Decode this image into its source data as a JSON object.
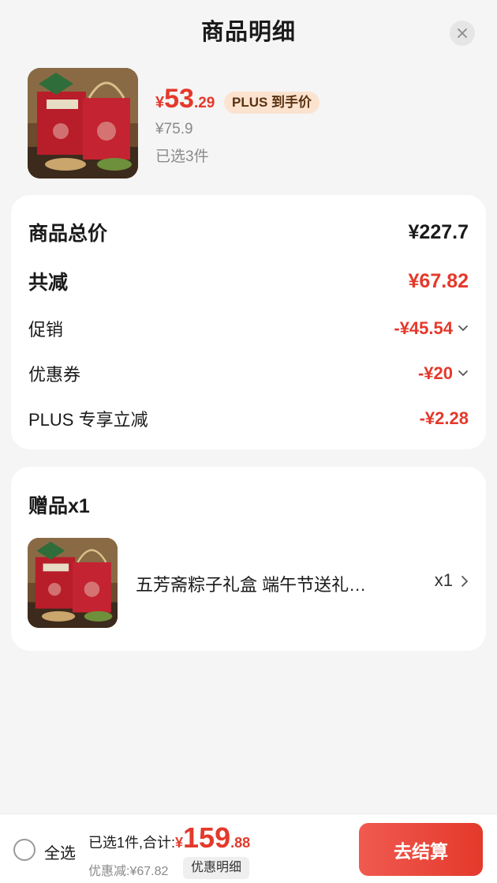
{
  "header": {
    "title": "商品明细"
  },
  "product": {
    "price_yen": "¥",
    "price_int": "53",
    "price_dec": ".29",
    "plus_badge": "PLUS 到手价",
    "original_price": "¥75.9",
    "selected_count": "已选3件"
  },
  "summary": {
    "rows": [
      {
        "label": "商品总价",
        "value": "¥227.7"
      },
      {
        "label": "共减",
        "value": "¥67.82"
      },
      {
        "label": "促销",
        "value": "-¥45.54"
      },
      {
        "label": "优惠券",
        "value": "-¥20"
      },
      {
        "label": "PLUS 专享立减",
        "value": "-¥2.28"
      }
    ]
  },
  "gift": {
    "title": "赠品x1",
    "name": "五芳斋粽子礼盒 端午节送礼…",
    "quantity": "x1"
  },
  "bottom_bar": {
    "select_all": "全选",
    "total_prefix": "已选1件,合计:",
    "total_yen": "¥",
    "total_int": "159",
    "total_dec": ".88",
    "discount_text": "优惠减:¥67.82",
    "detail_label": "优惠明细",
    "checkout_label": "去结算"
  },
  "colors": {
    "accent_red": "#e4392b",
    "plus_badge_bg": "#fbe3cf",
    "plus_badge_text": "#5a3212"
  },
  "icons": {
    "close": "close-icon",
    "chevron_down": "chevron-down-icon",
    "chevron_right": "chevron-right-icon"
  }
}
